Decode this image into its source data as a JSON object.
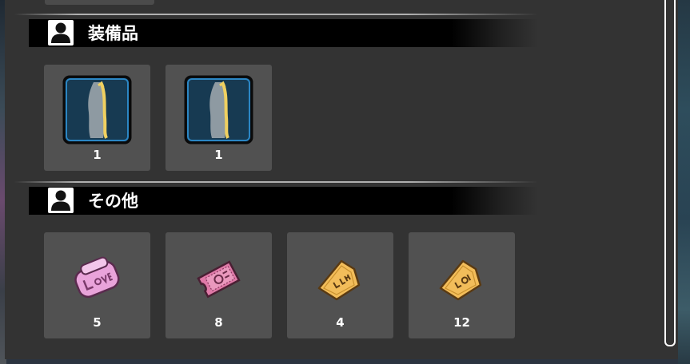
{
  "sections": [
    {
      "title": "装備品",
      "icon": "user-icon",
      "items": [
        {
          "icon": "leg-armor-icon",
          "count": "1"
        },
        {
          "icon": "leg-armor-icon",
          "count": "1"
        }
      ]
    },
    {
      "title": "その他",
      "icon": "user-icon",
      "items": [
        {
          "icon": "pink-ticket-love-icon",
          "count": "5"
        },
        {
          "icon": "pink-ticket-icon",
          "count": "8"
        },
        {
          "icon": "gold-ticket-icon",
          "count": "4"
        },
        {
          "icon": "gold-ticket-icon",
          "count": "12"
        }
      ]
    }
  ],
  "colors": {
    "panel": "#333333",
    "slot": "#515151",
    "header_band": "#000000",
    "pink_ticket": "#e8a0d8",
    "gold_ticket": "#f2bd5a",
    "armor_frame": "#1d6fa8"
  }
}
